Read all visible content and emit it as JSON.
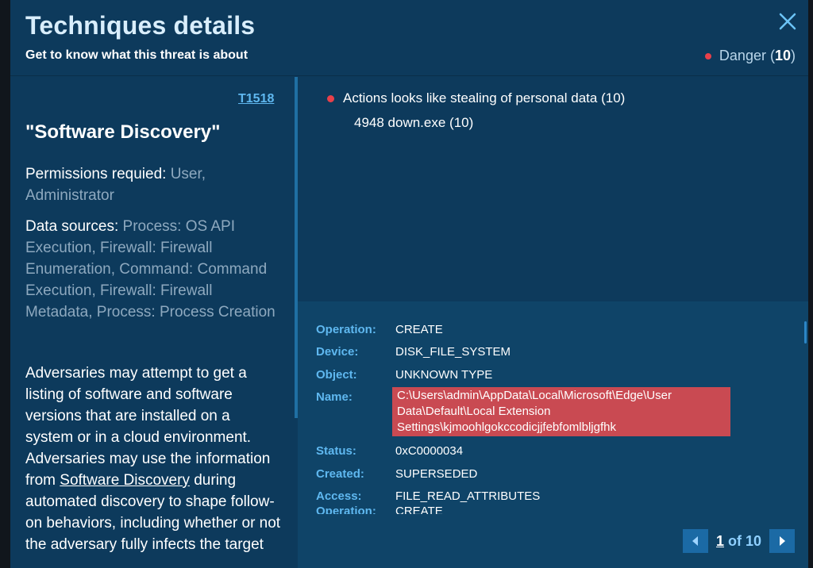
{
  "header": {
    "title": "Techniques details",
    "subtitle": "Get to know what this threat is about",
    "danger_label": "Danger",
    "danger_count_open": "(",
    "danger_count": "10",
    "danger_count_close": ")"
  },
  "technique": {
    "id": "T1518",
    "name": "\"Software Discovery\"",
    "permissions_label": "Permissions requied:",
    "permissions_value": "User, Administrator",
    "data_sources_label": "Data sources:",
    "data_sources_value": "Process: OS API Execution, Firewall: Firewall Enumeration, Command: Command Execution, Firewall: Firewall Metadata, Process: Process Creation",
    "description_part1": "Adversaries may attempt to get a listing of software and software versions that are installed on a system or in a cloud environment. Adversaries may use the information from ",
    "description_link": "Software Discovery",
    "description_part2": " during automated discovery to shape follow-on behaviors, including whether or not the adversary fully infects the target"
  },
  "action": {
    "title": "Actions looks like stealing of personal data (10)",
    "process": "4948 down.exe (10)"
  },
  "details": [
    {
      "key": "Operation:",
      "value": "CREATE"
    },
    {
      "key": "Device:",
      "value": "DISK_FILE_SYSTEM"
    },
    {
      "key": "Object:",
      "value": "UNKNOWN TYPE"
    },
    {
      "key": "Name:",
      "value": "C:\\Users\\admin\\AppData\\Local\\Microsoft\\Edge\\User Data\\Default\\Local Extension Settings\\kjmoohlgokccodicjjfebfomlbljgfhk"
    },
    {
      "key": "Status:",
      "value": "0xC0000034"
    },
    {
      "key": "Created:",
      "value": "SUPERSEDED"
    },
    {
      "key": "Access:",
      "value": "FILE_READ_ATTRIBUTES"
    },
    {
      "key": "Operation:",
      "value": "CREATE"
    }
  ],
  "pager": {
    "current": "1",
    "total": "of 10"
  },
  "colors": {
    "background": "#0d3a5c",
    "accent": "#5fb8f0",
    "danger": "#e8404a",
    "highlight": "#c94a52"
  },
  "icons": {
    "close": "close-icon",
    "prev": "chevron-left-icon",
    "next": "chevron-right-icon"
  }
}
